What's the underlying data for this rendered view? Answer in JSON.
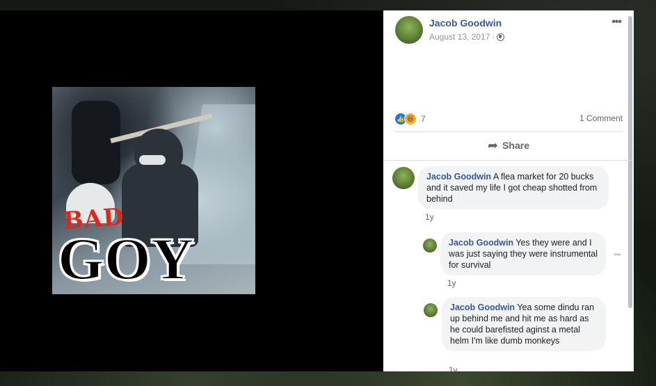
{
  "post": {
    "author": "Jacob Goodwin",
    "date": "August 13, 2017",
    "meta_sep": "·",
    "reaction_count": "7",
    "comment_count": "1 Comment",
    "share_label": "Share"
  },
  "photo": {
    "overlay_small": "BAD",
    "overlay_large": "GOY"
  },
  "comments": [
    {
      "author": "Jacob Goodwin",
      "text": "A flea market for 20 bucks and it saved my life I got cheap shotted from behind",
      "time": "1y"
    },
    {
      "author": "Jacob Goodwin",
      "text": "Yes they were and I was just saying they were instrumental for survival",
      "time": "1y"
    },
    {
      "author": "Jacob Goodwin",
      "text": "Yea some dindu ran up behind me and hit me as hard as he could barefisted aginst a metal helm I'm like dumb monkeys",
      "time": "1y"
    }
  ],
  "colors": {
    "link": "#385898",
    "like": "#1877f2",
    "haha": "#f7b125",
    "bubble": "#f2f3f5"
  }
}
